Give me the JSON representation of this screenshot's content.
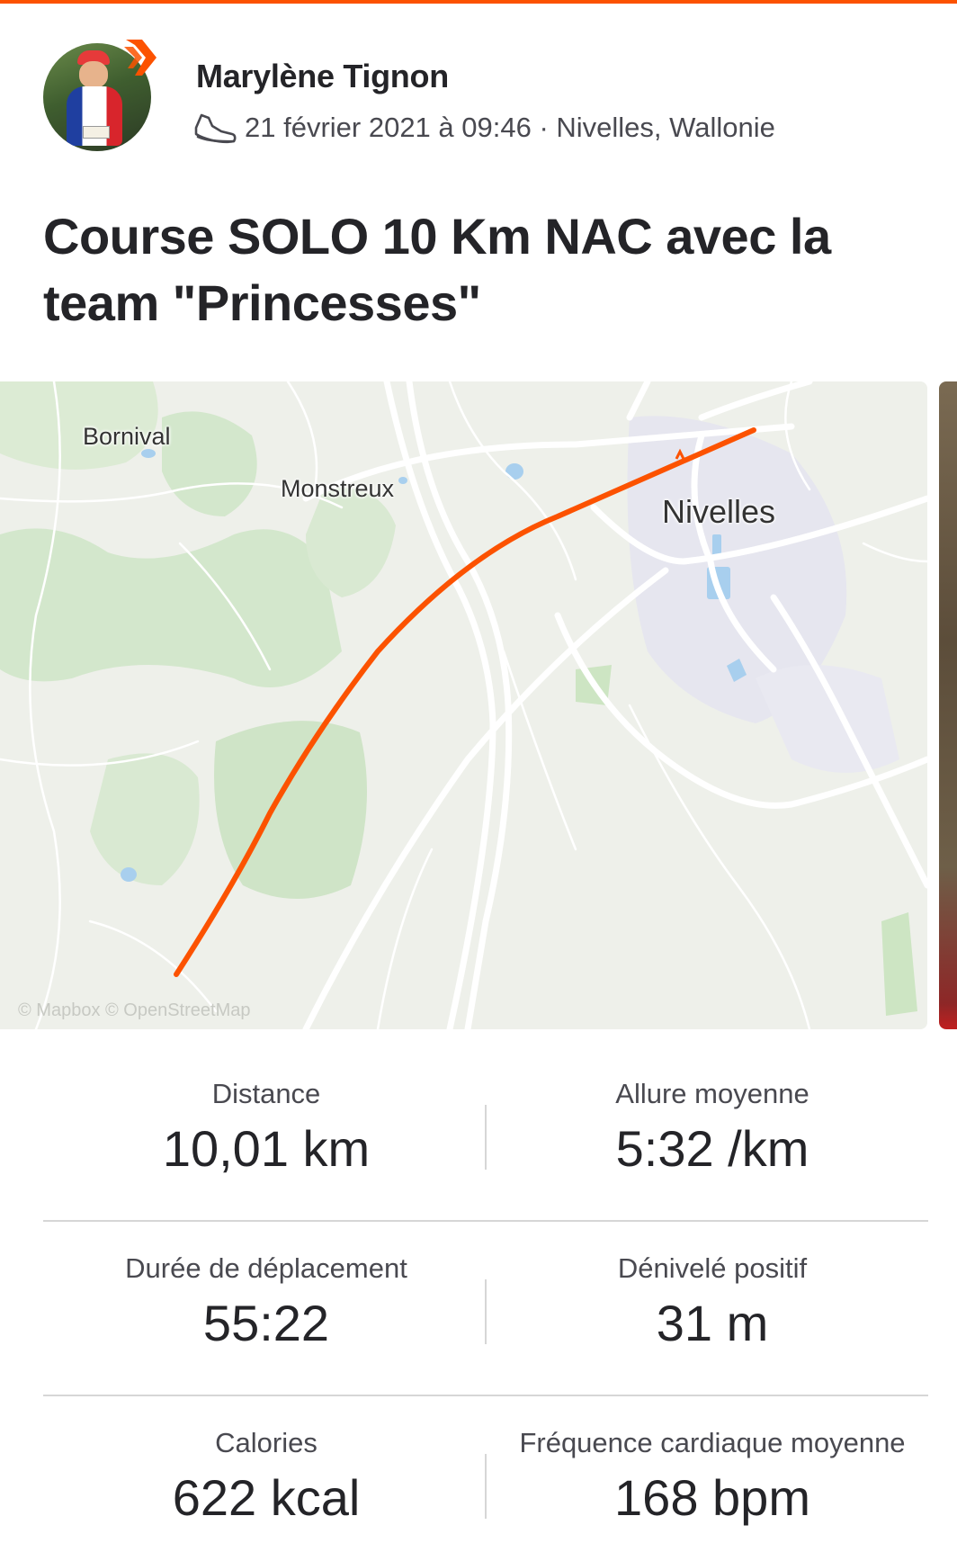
{
  "accent_color": "#fc5200",
  "header": {
    "athlete_name": "Marylène Tignon",
    "activity_type_icon": "running-shoe-icon",
    "meta": "21 février 2021 à 09:46 · Nivelles, Wallonie"
  },
  "activity": {
    "title": "Course SOLO 10 Km NAC avec la team \"Princesses\""
  },
  "map": {
    "places": {
      "bornival": "Bornival",
      "monstreux": "Monstreux",
      "nivelles": "Nivelles"
    },
    "attribution": "© Mapbox © OpenStreetMap",
    "route_color": "#fc5200"
  },
  "stats": [
    {
      "label": "Distance",
      "value": "10,01 km"
    },
    {
      "label": "Allure moyenne",
      "value": "5:32 /km"
    },
    {
      "label": "Durée de déplacement",
      "value": "55:22"
    },
    {
      "label": "Dénivelé positif",
      "value": "31 m"
    },
    {
      "label": "Calories",
      "value": "622 kcal"
    },
    {
      "label": "Fréquence cardiaque moyenne",
      "value": "168 bpm"
    }
  ]
}
